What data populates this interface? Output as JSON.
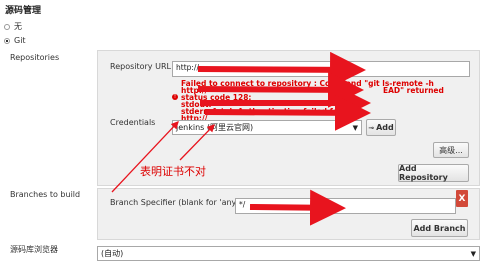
{
  "scm": {
    "title": "源码管理",
    "options": [
      {
        "label": "无",
        "selected": false
      },
      {
        "label": "Git",
        "selected": true
      }
    ]
  },
  "repositories": {
    "label": "Repositories",
    "url_label": "Repository URL",
    "url_value": "http://",
    "error_lines": [
      "Failed to connect to repository : Command \"git ls-remote -h",
      "http://",
      "status code 128:",
      "stdout:",
      "stderr: fatal: Authentication failed for",
      "http://"
    ],
    "error_returned_fragment": "EAD\" returned",
    "credentials_label": "Credentials",
    "credentials_value": "jenkins (阿里云官网)",
    "add_label": "Add",
    "advanced_label": "高级...",
    "add_repository_label": "Add Repository"
  },
  "annotation": {
    "text": "表明证书不对"
  },
  "branches": {
    "label": "Branches to build",
    "specifier_label": "Branch Specifier (blank for 'any')",
    "specifier_value": "*/",
    "delete_label": "X",
    "add_branch_label": "Add Branch"
  },
  "browser": {
    "label": "源码库浏览器",
    "value": "(自动)"
  },
  "colors": {
    "error": "#dd0000",
    "redaction": "#e8141e",
    "delete": "#d24939"
  }
}
